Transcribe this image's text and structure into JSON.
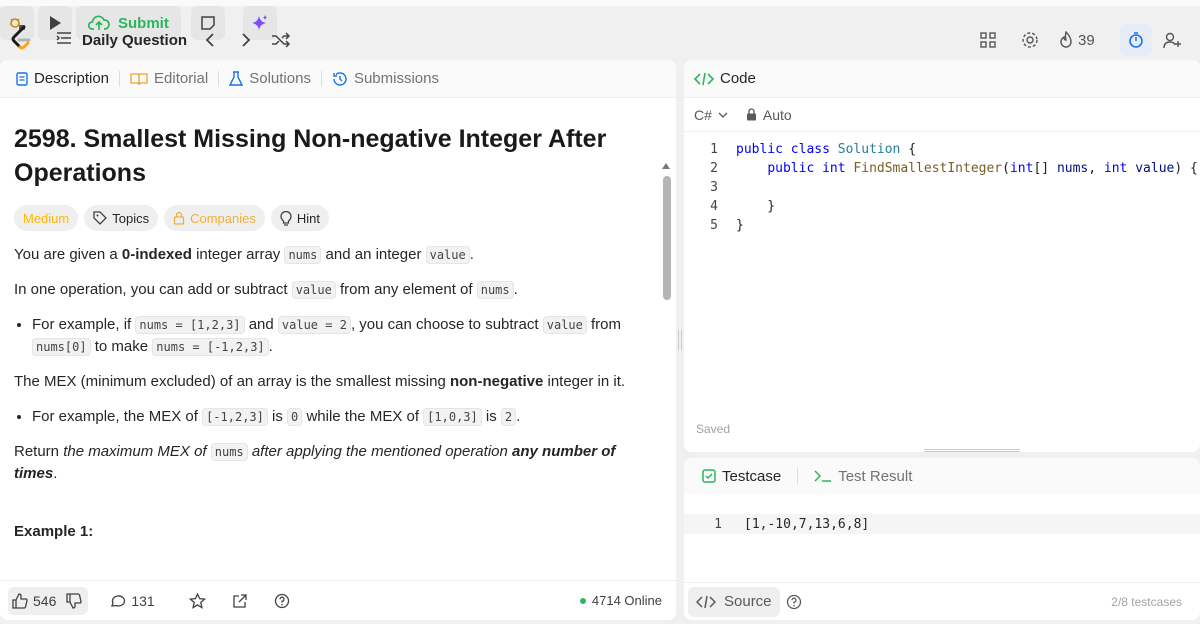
{
  "topbar": {
    "title": "Daily Question",
    "submit_label": "Submit",
    "streak": "39"
  },
  "left_tabs": {
    "description": "Description",
    "editorial": "Editorial",
    "solutions": "Solutions",
    "submissions": "Submissions"
  },
  "problem": {
    "title": "2598. Smallest Missing Non-negative Integer After Operations",
    "difficulty": "Medium",
    "tags": [
      "Topics",
      "Companies",
      "Hint"
    ],
    "p1_a": "You are given a ",
    "p1_b": "0-indexed",
    "p1_c": " integer array ",
    "p1_d": "nums",
    "p1_e": " and an integer ",
    "p1_f": "value",
    "p1_g": ".",
    "p2_a": "In one operation, you can add or subtract ",
    "p2_b": "value",
    "p2_c": " from any element of ",
    "p2_d": "nums",
    "p2_e": ".",
    "b1_a": "For example, if ",
    "b1_b": "nums = [1,2,3]",
    "b1_c": " and ",
    "b1_d": "value = 2",
    "b1_e": ", you can choose to subtract ",
    "b1_f": "value",
    "b1_g": " from ",
    "b1_h": "nums[0]",
    "b1_i": " to make ",
    "b1_j": "nums = [-1,2,3]",
    "b1_k": ".",
    "p3_a": "The MEX (minimum excluded) of an array is the smallest missing ",
    "p3_b": "non-negative",
    "p3_c": " integer in it.",
    "b2_a": "For example, the MEX of ",
    "b2_b": "[-1,2,3]",
    "b2_c": " is ",
    "b2_d": "0",
    "b2_e": " while the MEX of ",
    "b2_f": "[1,0,3]",
    "b2_g": " is ",
    "b2_h": "2",
    "b2_i": ".",
    "p4_a": "Return ",
    "p4_b": "the maximum MEX of ",
    "p4_c": "nums",
    "p4_d": " after applying the mentioned operation ",
    "p4_e": "any number of times",
    "p4_f": ".",
    "example_heading": "Example 1:"
  },
  "footer": {
    "likes": "546",
    "comments": "131",
    "online": "4714 Online"
  },
  "code_panel": {
    "tab_label": "Code",
    "language": "C#",
    "mode": "Auto",
    "line_numbers": [
      "1",
      "2",
      "3",
      "4",
      "5"
    ],
    "saved": "Saved"
  },
  "testcase_panel": {
    "testcase_tab": "Testcase",
    "result_tab": "Test Result",
    "input_line_number": "1",
    "input_value": "[1,-10,7,13,6,8]",
    "source_label": "Source",
    "testcases_count": "2/8 testcases"
  }
}
